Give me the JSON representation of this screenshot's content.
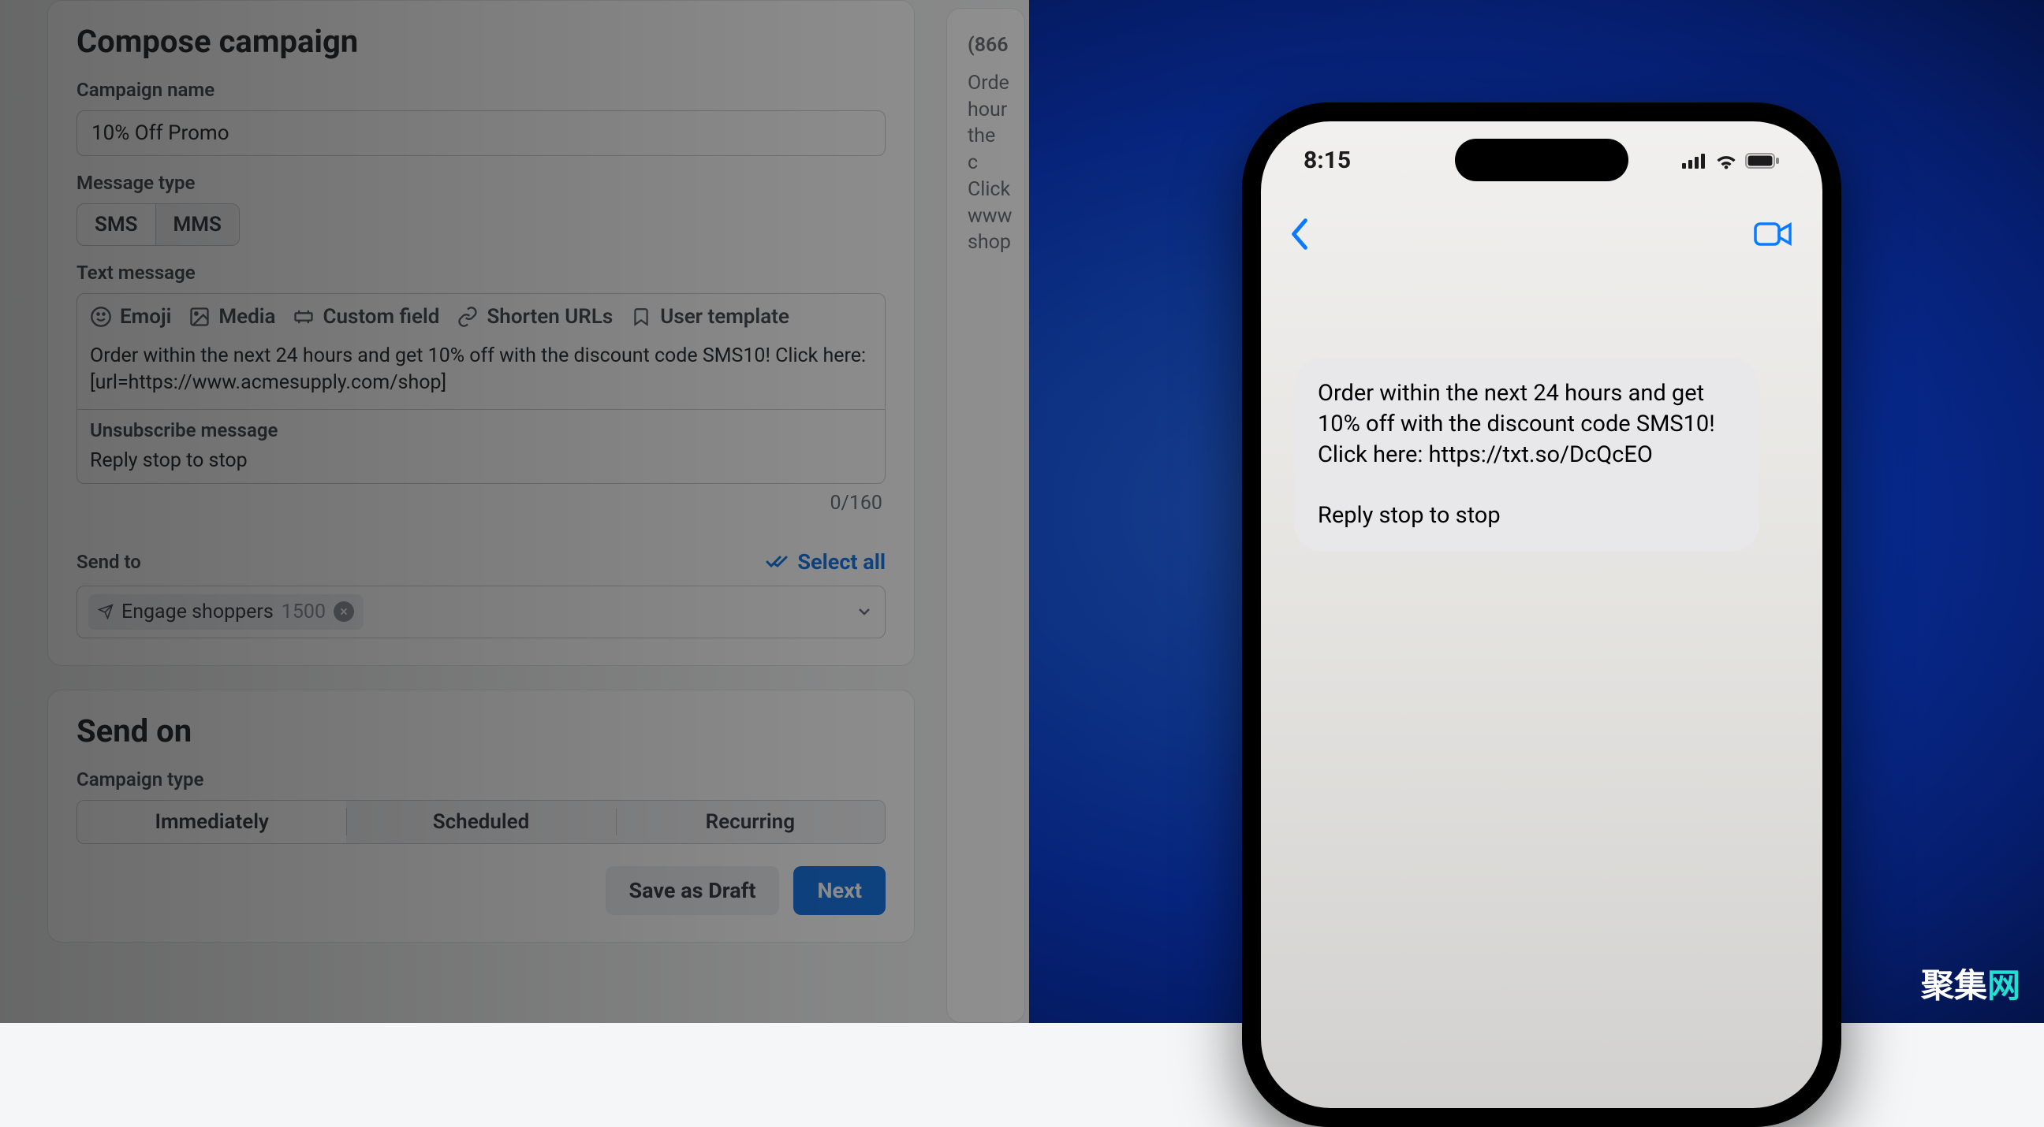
{
  "compose": {
    "title": "Compose campaign",
    "name_label": "Campaign name",
    "name_value": "10% Off Promo",
    "msg_type_label": "Message type",
    "msg_type_sms": "SMS",
    "msg_type_mms": "MMS",
    "text_label": "Text message",
    "tools": {
      "emoji": "Emoji",
      "media": "Media",
      "custom_field": "Custom field",
      "shorten": "Shorten URLs",
      "template": "User template"
    },
    "body": "Order within the next 24 hours and get 10% off with the discount code SMS10! Click here: [url=https://www.acmesupply.com/shop]",
    "unsub_label": "Unsubscribe message",
    "unsub_text": "Reply stop to stop",
    "char_count": "0/160",
    "sendto_label": "Send to",
    "select_all": "Select all",
    "chip_name": "Engage shoppers",
    "chip_count": "1500"
  },
  "sendon": {
    "title": "Send on",
    "type_label": "Campaign type",
    "opt_immediate": "Immediately",
    "opt_scheduled": "Scheduled",
    "opt_recurring": "Recurring",
    "save_draft": "Save as Draft",
    "next": "Next"
  },
  "preview_snip": {
    "number": "(866",
    "l1": "Orde",
    "l2": "hour",
    "l3": "the c",
    "l4": "Click",
    "l5": "www",
    "l6": "shop"
  },
  "phone": {
    "time": "8:15",
    "bubble_line1": "Order within the next 24 hours and get 10% off with the discount code SMS10! Click here: https://txt.so/DcQcEO",
    "bubble_line2": "Reply stop to stop"
  },
  "watermark": {
    "a": "聚集",
    "b": "网"
  }
}
